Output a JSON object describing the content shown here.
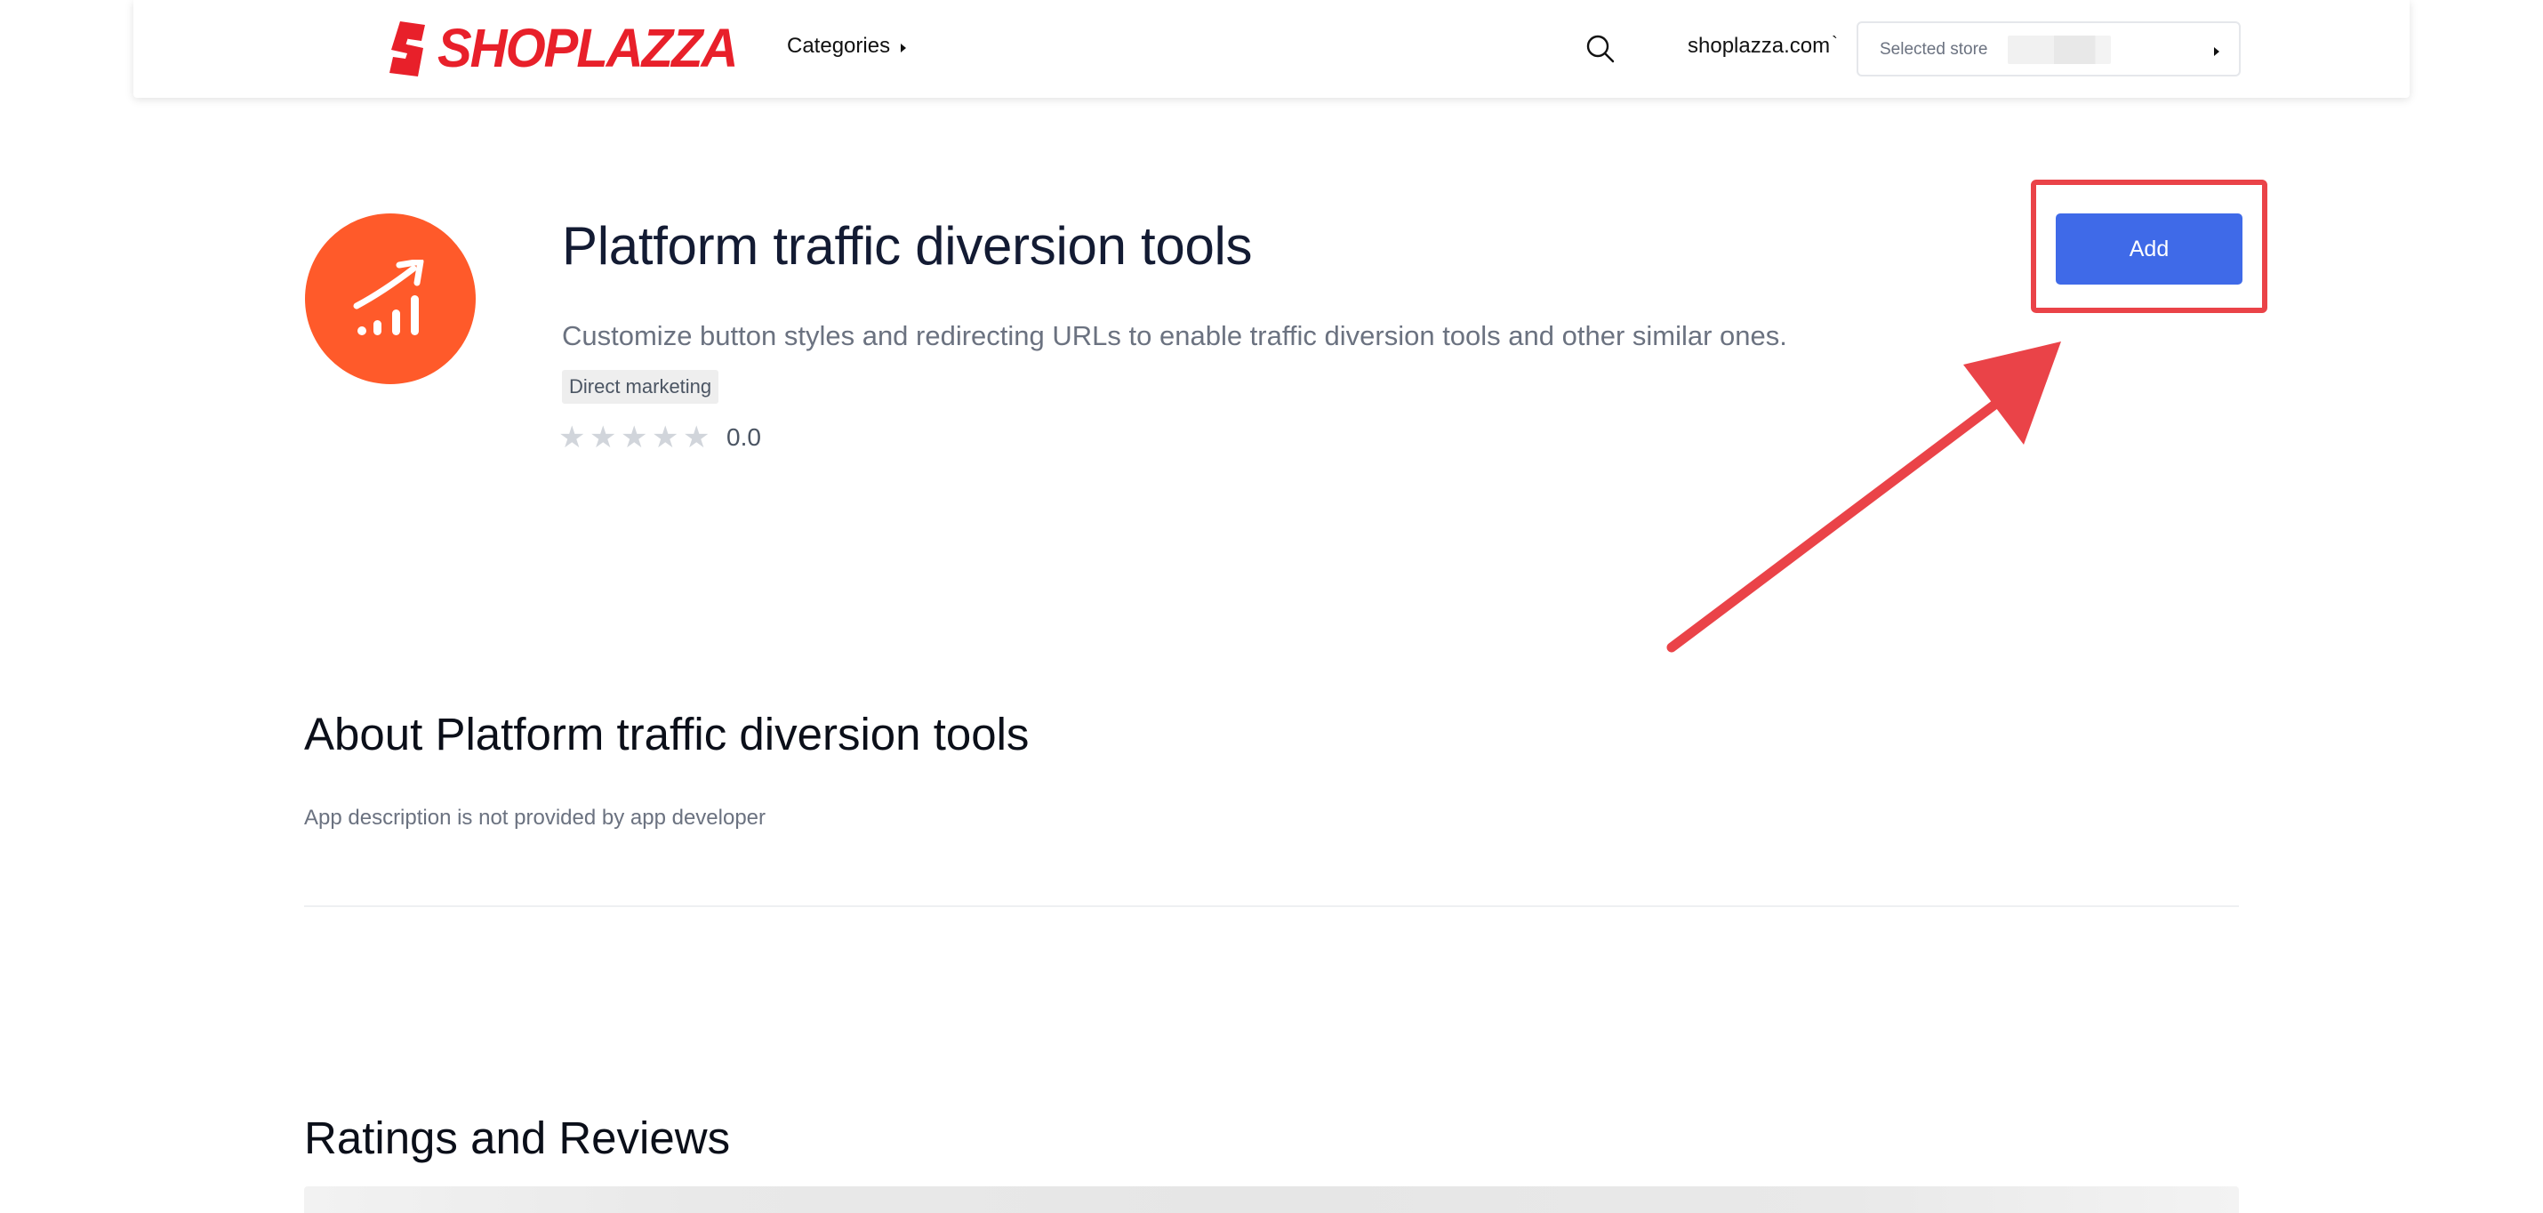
{
  "header": {
    "logo_text": "SHOPLAZZA",
    "categories_label": "Categories",
    "domain_label": "shoplazza.com",
    "domain_suffix": "`",
    "store_select_label": "Selected store"
  },
  "app": {
    "title": "Platform traffic diversion tools",
    "subtitle": "Customize button styles and redirecting URLs to enable traffic diversion tools and other similar ones.",
    "tag": "Direct marketing",
    "rating_value": "0.0",
    "rating_stars_filled": 0,
    "rating_stars_total": 5,
    "add_button_label": "Add"
  },
  "about": {
    "title": "About Platform traffic diversion tools",
    "description": "App description is not provided by app developer"
  },
  "ratings": {
    "title": "Ratings and Reviews"
  },
  "icons": {
    "logo": "shoplazza-logo-icon",
    "search": "search-icon",
    "app": "trending-up-chart-icon",
    "star": "star-icon",
    "caret": "caret-right-icon"
  },
  "colors": {
    "brand_red": "#e8202a",
    "app_icon_bg": "#ff5a2a",
    "primary_button": "#3f6ae8",
    "annotation_red": "#ea4348",
    "star_empty": "#d1d5db"
  }
}
